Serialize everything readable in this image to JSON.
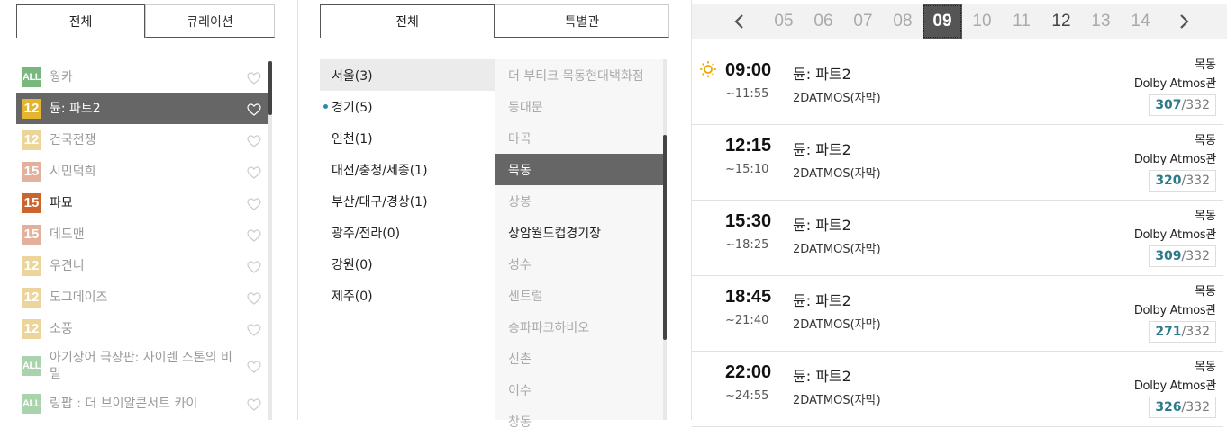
{
  "movie_panel": {
    "tabs": [
      "전체",
      "큐레이션"
    ],
    "movies": [
      {
        "rating": "ALL",
        "rating_color": "#78b87e",
        "title": "웡카",
        "state": "normal"
      },
      {
        "rating": "12",
        "rating_color": "#e4b433",
        "title": "듄: 파트2",
        "state": "selected"
      },
      {
        "rating": "12",
        "rating_color": "#ecd59b",
        "title": "건국전쟁",
        "state": "normal"
      },
      {
        "rating": "15",
        "rating_color": "#e3b09c",
        "title": "시민덕희",
        "state": "normal"
      },
      {
        "rating": "15",
        "rating_color": "#c9652d",
        "title": "파묘",
        "state": "dark"
      },
      {
        "rating": "15",
        "rating_color": "#e3b09c",
        "title": "데드맨",
        "state": "normal"
      },
      {
        "rating": "12",
        "rating_color": "#ecd59b",
        "title": "우견니",
        "state": "normal"
      },
      {
        "rating": "12",
        "rating_color": "#ecd59b",
        "title": "도그데이즈",
        "state": "normal"
      },
      {
        "rating": "12",
        "rating_color": "#ecd59b",
        "title": "소풍",
        "state": "normal"
      },
      {
        "rating": "ALL",
        "rating_color": "#a8d3ac",
        "title": "아기상어 극장판: 사이렌 스톤의 비밀",
        "state": "normal"
      },
      {
        "rating": "ALL",
        "rating_color": "#a8d3ac",
        "title": "링팝 : 더 브이알콘서트 카이",
        "state": "normal"
      }
    ]
  },
  "theater_panel": {
    "tabs": [
      "전체",
      "특별관"
    ],
    "regions": [
      {
        "label": "서울(3)",
        "state": "selected"
      },
      {
        "label": "경기(5)",
        "state": "dot"
      },
      {
        "label": "인천(1)",
        "state": "normal"
      },
      {
        "label": "대전/충청/세종(1)",
        "state": "normal"
      },
      {
        "label": "부산/대구/경상(1)",
        "state": "normal"
      },
      {
        "label": "광주/전라(0)",
        "state": "normal"
      },
      {
        "label": "강원(0)",
        "state": "normal"
      },
      {
        "label": "제주(0)",
        "state": "normal"
      }
    ],
    "theaters": [
      {
        "label": "더 부티크 목동현대백화점",
        "state": "normal"
      },
      {
        "label": "동대문",
        "state": "normal"
      },
      {
        "label": "마곡",
        "state": "normal"
      },
      {
        "label": "목동",
        "state": "selected"
      },
      {
        "label": "상봉",
        "state": "normal"
      },
      {
        "label": "상암월드컵경기장",
        "state": "dark"
      },
      {
        "label": "성수",
        "state": "normal"
      },
      {
        "label": "센트럴",
        "state": "normal"
      },
      {
        "label": "송파파크하비오",
        "state": "normal"
      },
      {
        "label": "신촌",
        "state": "normal"
      },
      {
        "label": "이수",
        "state": "normal"
      },
      {
        "label": "창동",
        "state": "normal"
      }
    ]
  },
  "date_bar": {
    "prev_icon": "chevron-left-icon",
    "next_icon": "chevron-right-icon",
    "dates": [
      {
        "label": "05",
        "state": "normal"
      },
      {
        "label": "06",
        "state": "normal"
      },
      {
        "label": "07",
        "state": "normal"
      },
      {
        "label": "08",
        "state": "normal"
      },
      {
        "label": "09",
        "state": "selected"
      },
      {
        "label": "10",
        "state": "normal"
      },
      {
        "label": "11",
        "state": "normal"
      },
      {
        "label": "12",
        "state": "dark"
      },
      {
        "label": "13",
        "state": "normal"
      },
      {
        "label": "14",
        "state": "normal"
      }
    ]
  },
  "showtimes": [
    {
      "icon": "sun-icon",
      "start": "09:00",
      "end": "~11:55",
      "title": "듄: 파트2",
      "format": "2DATMOS(자막)",
      "place": "목동",
      "hall": "Dolby Atmos관",
      "available": "307",
      "total": "/332"
    },
    {
      "icon": "",
      "start": "12:15",
      "end": "~15:10",
      "title": "듄: 파트2",
      "format": "2DATMOS(자막)",
      "place": "목동",
      "hall": "Dolby Atmos관",
      "available": "320",
      "total": "/332"
    },
    {
      "icon": "",
      "start": "15:30",
      "end": "~18:25",
      "title": "듄: 파트2",
      "format": "2DATMOS(자막)",
      "place": "목동",
      "hall": "Dolby Atmos관",
      "available": "309",
      "total": "/332"
    },
    {
      "icon": "",
      "start": "18:45",
      "end": "~21:40",
      "title": "듄: 파트2",
      "format": "2DATMOS(자막)",
      "place": "목동",
      "hall": "Dolby Atmos관",
      "available": "271",
      "total": "/332"
    },
    {
      "icon": "",
      "start": "22:00",
      "end": "~24:55",
      "title": "듄: 파트2",
      "format": "2DATMOS(자막)",
      "place": "목동",
      "hall": "Dolby Atmos관",
      "available": "326",
      "total": "/332"
    }
  ],
  "colors": {
    "selected_bg": "#666666",
    "accent_seats": "#2d7a8a",
    "sun_icon": "#f0a500"
  }
}
